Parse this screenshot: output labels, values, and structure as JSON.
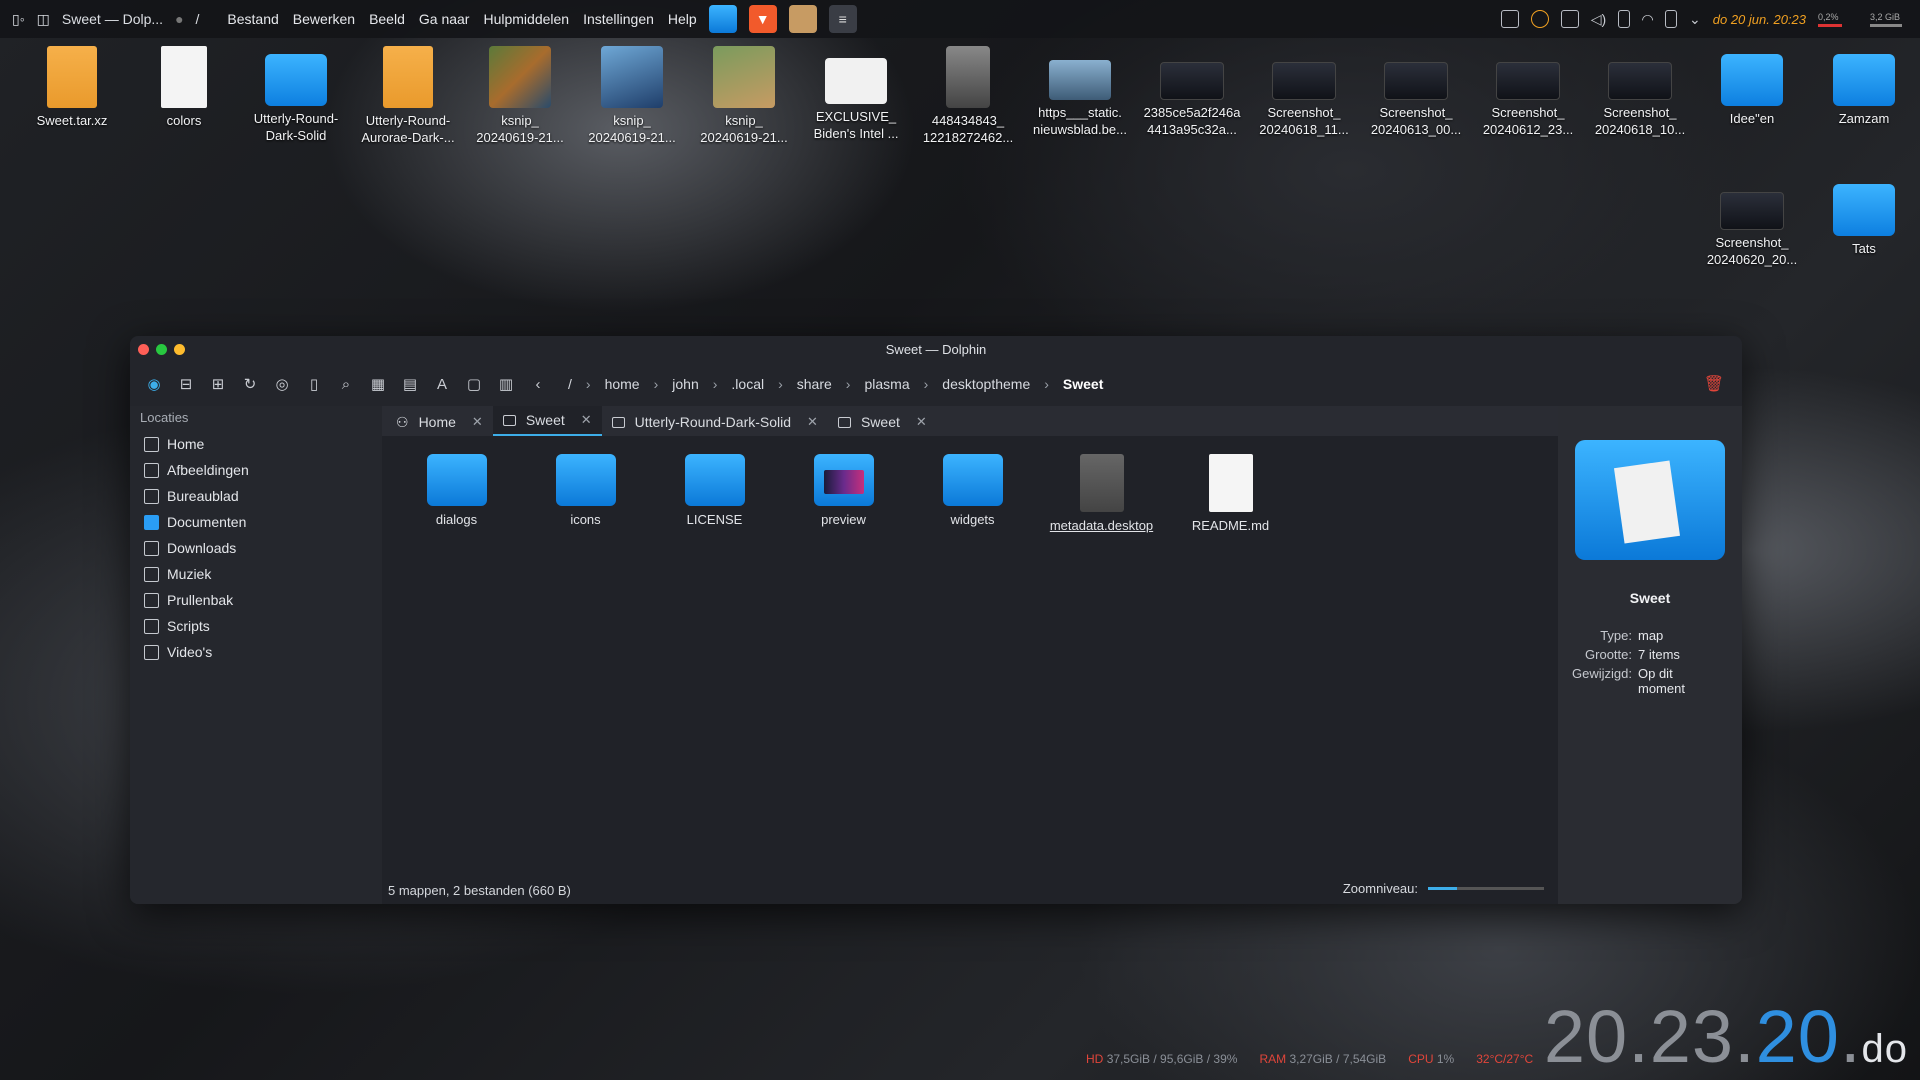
{
  "panel": {
    "window_title": "Sweet — Dolp...",
    "separator": "/",
    "menu": [
      "Bestand",
      "Bewerken",
      "Beeld",
      "Ga naar",
      "Hulpmiddelen",
      "Instellingen",
      "Help"
    ],
    "date": "do 20 jun. 20:23",
    "cpu_mini": "0,2%",
    "mem_mini": "3,2 GiB"
  },
  "desktop_icons": [
    {
      "label": "Sweet.tar.xz",
      "kind": "archive"
    },
    {
      "label": "colors",
      "kind": "doc"
    },
    {
      "label": "Utterly-Round-\nDark-Solid",
      "kind": "folder"
    },
    {
      "label": "Utterly-Round-\nAurorae-Dark-...",
      "kind": "archive"
    },
    {
      "label": "ksnip_\n20240619-21...",
      "kind": "photo"
    },
    {
      "label": "ksnip_\n20240619-21...",
      "kind": "photo2"
    },
    {
      "label": "ksnip_\n20240619-21...",
      "kind": "photo3"
    },
    {
      "label": "EXCLUSIVE_\nBiden's Intel ...",
      "kind": "white"
    },
    {
      "label": "448434843_\n12218272462...",
      "kind": "grey"
    },
    {
      "label": "https___static.\nnieuwsblad.be...",
      "kind": "bridge"
    },
    {
      "label": "2385ce5a2f246a\n4413a95c32a...",
      "kind": "shot"
    },
    {
      "label": "Screenshot_\n20240618_11...",
      "kind": "shot"
    },
    {
      "label": "Screenshot_\n20240613_00...",
      "kind": "shot"
    },
    {
      "label": "Screenshot_\n20240612_23...",
      "kind": "shot"
    },
    {
      "label": "Screenshot_\n20240618_10...",
      "kind": "shot"
    },
    {
      "label": "Idee\"en",
      "kind": "fphoto"
    },
    {
      "label": "Zamzam",
      "kind": "fphoto"
    },
    {
      "label": "Screenshot_\n20240620_20...",
      "kind": "shot"
    },
    {
      "label": "Tats",
      "kind": "fphoto"
    }
  ],
  "window": {
    "title": "Sweet — Dolphin",
    "breadcrumb": [
      "/",
      "home",
      "john",
      ".local",
      "share",
      "plasma",
      "desktoptheme",
      "Sweet"
    ],
    "sidebar_heading": "Locaties",
    "sidebar": [
      "Home",
      "Afbeeldingen",
      "Bureaublad",
      "Documenten",
      "Downloads",
      "Muziek",
      "Prullenbak",
      "Scripts",
      "Video's"
    ],
    "tabs": [
      "Home",
      "Sweet",
      "Utterly-Round-Dark-Solid",
      "Sweet"
    ],
    "files": [
      "dialogs",
      "icons",
      "LICENSE",
      "preview",
      "widgets",
      "metadata.desktop",
      "README.md"
    ],
    "status": "5 mappen, 2 bestanden (660 B)",
    "zoom_label": "Zoomniveau:",
    "zoom_level": 0.25,
    "info": {
      "name": "Sweet",
      "type_k": "Type:",
      "type_v": "map",
      "size_k": "Grootte:",
      "size_v": "7 items",
      "mod_k": "Gewijzigd:",
      "mod_v": "Op dit moment"
    }
  },
  "stats": {
    "hd_label": "HD",
    "hd_value": "37,5GiB / 95,6GiB / 39%",
    "ram_label": "RAM",
    "ram_value": "3,27GiB / 7,54GiB",
    "cpu_label": "CPU",
    "cpu_value": "1%",
    "temp": "32°C/27°C"
  },
  "clock": {
    "h": "20",
    "m": "23",
    "s": "20",
    "day": "do"
  },
  "colors": {
    "accent": "#3daee9",
    "close": "#ff5f57",
    "min": "#28c840",
    "max": "#febc2e",
    "warn": "#e0453a"
  }
}
